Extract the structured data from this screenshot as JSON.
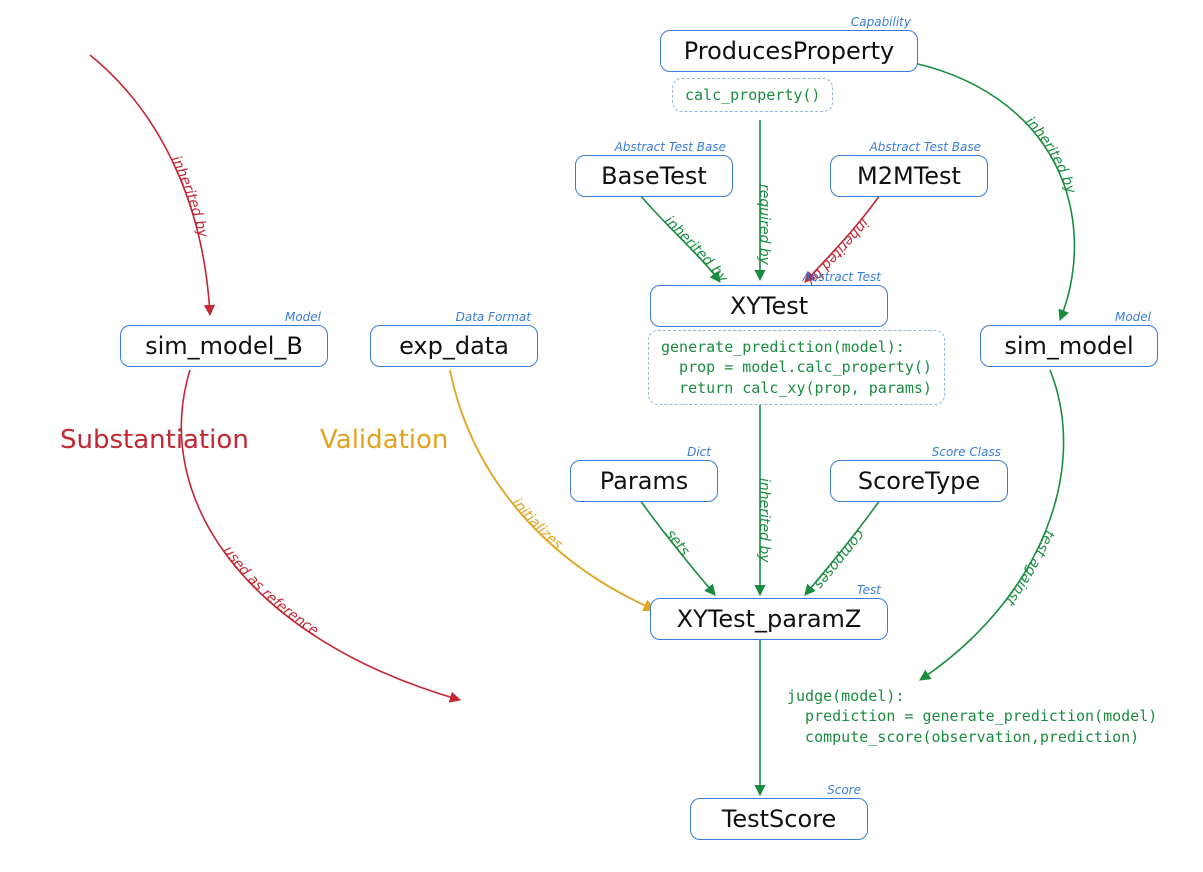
{
  "nodes": {
    "produces_property": {
      "label": "ProducesProperty",
      "tag": "Capability"
    },
    "base_test": {
      "label": "BaseTest",
      "tag": "Abstract Test Base"
    },
    "m2m_test": {
      "label": "M2MTest",
      "tag": "Abstract Test Base"
    },
    "xy_test": {
      "label": "XYTest",
      "tag": "Abstract Test"
    },
    "params": {
      "label": "Params",
      "tag": "Dict"
    },
    "score_type": {
      "label": "ScoreType",
      "tag": "Score Class"
    },
    "xy_test_paramz": {
      "label": "XYTest_paramZ",
      "tag": "Test"
    },
    "test_score": {
      "label": "TestScore",
      "tag": "Score"
    },
    "sim_model": {
      "label": "sim_model",
      "tag": "Model"
    },
    "sim_model_b": {
      "label": "sim_model_B",
      "tag": "Model"
    },
    "exp_data": {
      "label": "exp_data",
      "tag": "Data Format"
    }
  },
  "code": {
    "calc_property": "calc_property()",
    "generate_prediction": "generate_prediction(model):\n  prop = model.calc_property()\n  return calc_xy(prop, params)",
    "judge": "judge(model):\n  prediction = generate_prediction(model)\n  compute_score(observation,prediction)"
  },
  "section_labels": {
    "substantiation": "Substantiation",
    "validation": "Validation"
  },
  "edges": {
    "pp_to_xytest": {
      "label": "required by",
      "color": "green"
    },
    "pp_to_simmodel": {
      "label": "inherited by",
      "color": "green"
    },
    "basetest_to_xytest": {
      "label": "inherited by",
      "color": "green"
    },
    "m2m_to_xytest": {
      "label": "inherited by",
      "color": "red"
    },
    "xytest_to_paramz": {
      "label": "inherited by",
      "color": "green"
    },
    "params_to_paramz": {
      "label": "sets",
      "color": "green"
    },
    "scoretype_to_paramz": {
      "label": "composes",
      "color": "green"
    },
    "paramz_to_score": {
      "label": "",
      "color": "green"
    },
    "simmodel_to_judge": {
      "label": "test against",
      "color": "green"
    },
    "expdata_to_paramz": {
      "label": "initializes",
      "color": "gold"
    },
    "simb_to_simb": {
      "label": "inherited by",
      "color": "red"
    },
    "simb_to_judge": {
      "label": "used as reference",
      "color": "red"
    }
  },
  "chart_data": {
    "type": "diagram",
    "title": "",
    "entities": [
      {
        "id": "ProducesProperty",
        "stereotype": "Capability",
        "methods": [
          "calc_property()"
        ]
      },
      {
        "id": "BaseTest",
        "stereotype": "Abstract Test Base"
      },
      {
        "id": "M2MTest",
        "stereotype": "Abstract Test Base"
      },
      {
        "id": "XYTest",
        "stereotype": "Abstract Test",
        "methods": [
          "generate_prediction(model): prop = model.calc_property(); return calc_xy(prop, params)"
        ]
      },
      {
        "id": "Params",
        "stereotype": "Dict"
      },
      {
        "id": "ScoreType",
        "stereotype": "Score Class"
      },
      {
        "id": "XYTest_paramZ",
        "stereotype": "Test",
        "methods": [
          "judge(model): prediction = generate_prediction(model); compute_score(observation, prediction)"
        ]
      },
      {
        "id": "TestScore",
        "stereotype": "Score"
      },
      {
        "id": "sim_model",
        "stereotype": "Model"
      },
      {
        "id": "sim_model_B",
        "stereotype": "Model"
      },
      {
        "id": "exp_data",
        "stereotype": "Data Format"
      }
    ],
    "relations": [
      {
        "from": "ProducesProperty",
        "to": "XYTest",
        "label": "required by",
        "group": "validation"
      },
      {
        "from": "ProducesProperty",
        "to": "sim_model",
        "label": "inherited by",
        "group": "validation"
      },
      {
        "from": "BaseTest",
        "to": "XYTest",
        "label": "inherited by",
        "group": "validation"
      },
      {
        "from": "M2MTest",
        "to": "XYTest",
        "label": "inherited by",
        "group": "substantiation"
      },
      {
        "from": "XYTest",
        "to": "XYTest_paramZ",
        "label": "inherited by",
        "group": "validation"
      },
      {
        "from": "Params",
        "to": "XYTest_paramZ",
        "label": "sets",
        "group": "validation"
      },
      {
        "from": "ScoreType",
        "to": "XYTest_paramZ",
        "label": "composes",
        "group": "validation"
      },
      {
        "from": "XYTest_paramZ",
        "to": "TestScore",
        "label": "",
        "group": "validation"
      },
      {
        "from": "sim_model",
        "to": "XYTest_paramZ.judge",
        "label": "test against",
        "group": "validation"
      },
      {
        "from": "exp_data",
        "to": "XYTest_paramZ",
        "label": "initializes",
        "group": "validation"
      },
      {
        "from": "(origin)",
        "to": "sim_model_B",
        "label": "inherited by",
        "group": "substantiation"
      },
      {
        "from": "sim_model_B",
        "to": "XYTest_paramZ.judge",
        "label": "used as reference",
        "group": "substantiation"
      }
    ],
    "legend": {
      "validation_color": "green  (#1a8c3f)",
      "substantiation_color": "red    (#c22733)",
      "initialization_color": "gold   (#e2a31e)"
    }
  }
}
